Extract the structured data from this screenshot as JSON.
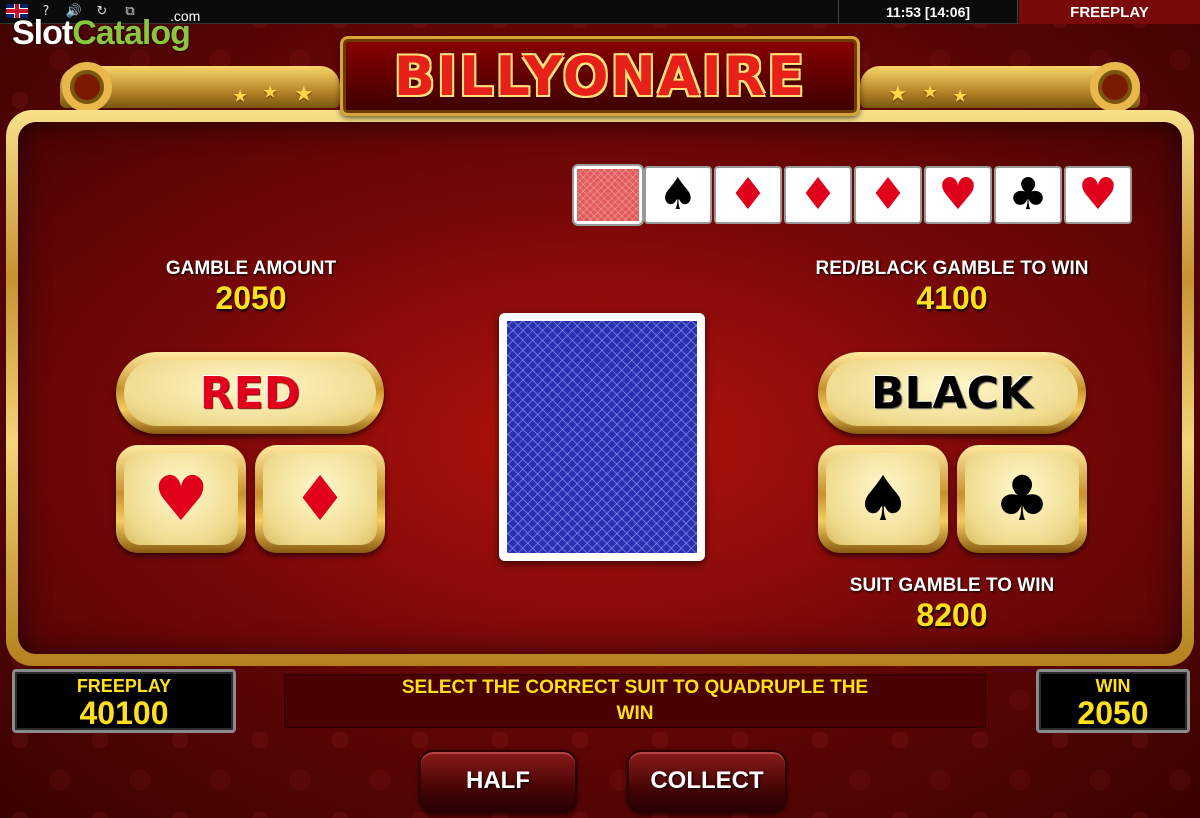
{
  "topbar": {
    "help_glyph": "?",
    "sound_glyph": "🔊",
    "refresh_glyph": "↻",
    "fullscreen_glyph": "⧉",
    "clock": "11:53 [14:06]",
    "mode": "FREEPLAY"
  },
  "watermark": {
    "part1": "Slot",
    "part2": "Catalog",
    "suffix": ".com"
  },
  "game": {
    "title": "BILLYONAIRE"
  },
  "history": {
    "cards": [
      {
        "suit": "card-back",
        "glyph": ""
      },
      {
        "suit": "spade",
        "glyph": "♠"
      },
      {
        "suit": "diamond",
        "glyph": "♦"
      },
      {
        "suit": "diamond",
        "glyph": "♦"
      },
      {
        "suit": "diamond",
        "glyph": "♦"
      },
      {
        "suit": "heart",
        "glyph": "♥"
      },
      {
        "suit": "club",
        "glyph": "♣"
      },
      {
        "suit": "heart",
        "glyph": "♥"
      }
    ]
  },
  "gamble": {
    "amount_label": "GAMBLE AMOUNT",
    "amount_value": "2050",
    "redblack_label": "RED/BLACK GAMBLE TO WIN",
    "redblack_value": "4100",
    "suit_label": "SUIT GAMBLE TO WIN",
    "suit_value": "8200"
  },
  "buttons": {
    "red": "RED",
    "black": "BLACK",
    "heart": "♥",
    "diamond": "♦",
    "spade": "♠",
    "club": "♣",
    "half": "HALF",
    "collect": "COLLECT"
  },
  "footer": {
    "credit_label": "FREEPLAY",
    "credit_value": "40100",
    "message": "SELECT THE CORRECT SUIT TO QUADRUPLE THE WIN",
    "win_label": "WIN",
    "win_value": "2050"
  },
  "colors": {
    "red_suit": "#e0001b",
    "black_suit": "#000000",
    "value_yellow": "#ffe01a",
    "card_back_blue": "#2a2fb0"
  }
}
